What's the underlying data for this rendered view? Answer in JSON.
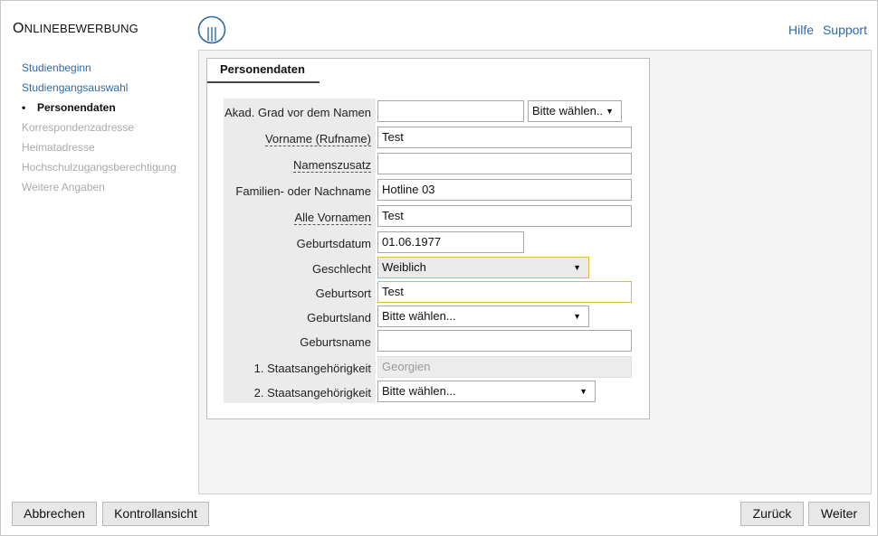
{
  "header": {
    "title_first": "O",
    "title_rest": "NLINEBEWERBUNG",
    "links": {
      "help": "Hilfe",
      "support": "Support"
    }
  },
  "sidebar": {
    "items": [
      {
        "label": "Studienbeginn",
        "state": "link"
      },
      {
        "label": "Studiengangsauswahl",
        "state": "link"
      },
      {
        "label": "Personendaten",
        "state": "active"
      },
      {
        "label": "Korrespondenzadresse",
        "state": "disabled"
      },
      {
        "label": "Heimatadresse",
        "state": "disabled"
      },
      {
        "label": "Hochschulzugangsberechtigung",
        "state": "disabled"
      },
      {
        "label": "Weitere Angaben",
        "state": "disabled"
      }
    ],
    "active_bullet": "•"
  },
  "form": {
    "tab_label": "Personendaten",
    "fields": {
      "akad_grad": {
        "label": "Akad. Grad vor dem Namen",
        "value": "",
        "select_value": "Bitte wählen.."
      },
      "vorname": {
        "label": "Vorname (Rufname)",
        "value": "Test"
      },
      "namenszusatz": {
        "label": "Namenszusatz",
        "value": ""
      },
      "nachname": {
        "label": "Familien- oder Nachname",
        "value": "Hotline 03"
      },
      "alle_vornamen": {
        "label": "Alle Vornamen",
        "value": "Test"
      },
      "geburtsdatum": {
        "label": "Geburtsdatum",
        "value": "01.06.1977"
      },
      "geschlecht": {
        "label": "Geschlecht",
        "value": "Weiblich"
      },
      "geburtsort": {
        "label": "Geburtsort",
        "value": "Test"
      },
      "geburtsland": {
        "label": "Geburtsland",
        "value": "Bitte wählen..."
      },
      "geburtsname": {
        "label": "Geburtsname",
        "value": ""
      },
      "staatsang1": {
        "label": "1. Staatsangehörigkeit",
        "value": "Georgien"
      },
      "staatsang2": {
        "label": "2. Staatsangehörigkeit",
        "value": "Bitte wählen..."
      }
    },
    "dropdown_arrow": "▼"
  },
  "footer": {
    "cancel": "Abbrechen",
    "review": "Kontrollansicht",
    "back": "Zurück",
    "next": "Weiter"
  },
  "colors": {
    "link": "#2f6aa8",
    "highlight_border": "#e2b93d",
    "label_column_bg": "#ebebeb",
    "panel_bg": "#f4f4f4"
  },
  "icons": {
    "logo": "university-logo-icon",
    "dropdown": "chevron-down-icon"
  }
}
